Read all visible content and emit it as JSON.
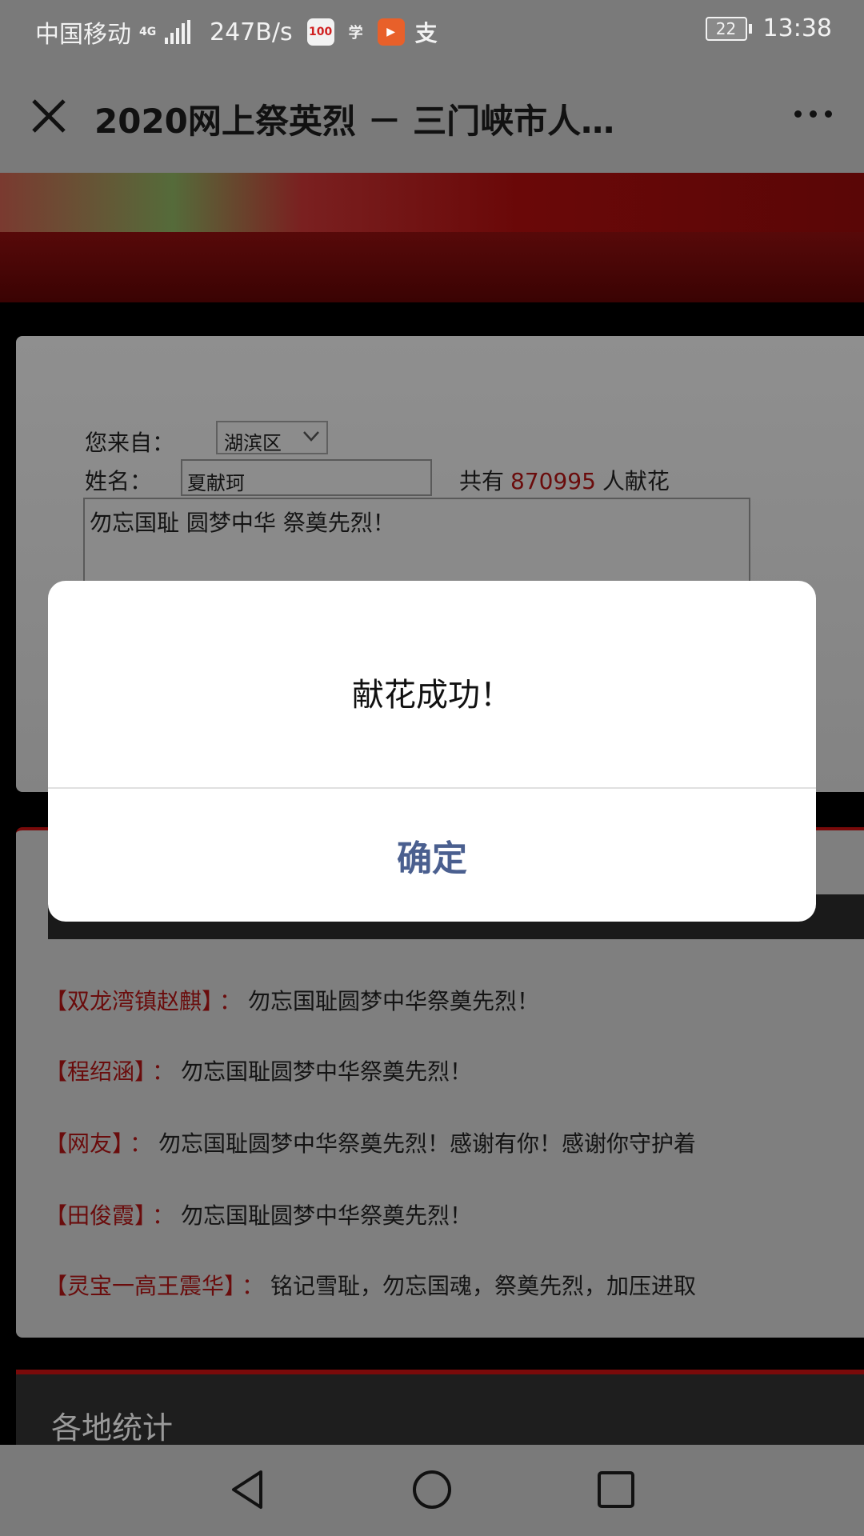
{
  "status_bar": {
    "carrier": "中国移动",
    "network_type": "4G",
    "speed": "247B/s",
    "app_icons": [
      "100-app-icon",
      "xuexi-app-icon",
      "video-app-icon",
      "alipay-app-icon"
    ],
    "battery": "22",
    "time": "13:38"
  },
  "title_bar": {
    "title": "2020网上祭英烈 － 三门峡市人…"
  },
  "form": {
    "from_label": "您来自：",
    "district_value": "湖滨区",
    "name_label": "姓名：",
    "name_value": "夏献珂",
    "count_prefix": "共有",
    "count_value": "870995",
    "count_suffix": "人献花",
    "message_value": "勿忘国耻 圆梦中华 祭奠先烈！"
  },
  "messages": [
    {
      "name": "【双龙湾镇赵麒】",
      "sep": "：",
      "text": "勿忘国耻圆梦中华祭奠先烈！"
    },
    {
      "name": "【程绍涵】",
      "sep": "：",
      "text": "勿忘国耻圆梦中华祭奠先烈！"
    },
    {
      "name": "【网友】",
      "sep": "：",
      "text": "勿忘国耻圆梦中华祭奠先烈！感谢有你！感谢你守护着"
    },
    {
      "name": "【田俊霞】",
      "sep": "：",
      "text": "勿忘国耻圆梦中华祭奠先烈！"
    },
    {
      "name": "【灵宝一高王震华】",
      "sep": "：",
      "text": "铭记雪耻，勿忘国魂，祭奠先烈，加压进取"
    }
  ],
  "stats": {
    "title": "各地统计"
  },
  "dialog": {
    "message": "献花成功！",
    "confirm_label": "确定"
  },
  "colors": {
    "accent_red": "#6a0c0c",
    "dialog_button": "#4a5f8f"
  }
}
